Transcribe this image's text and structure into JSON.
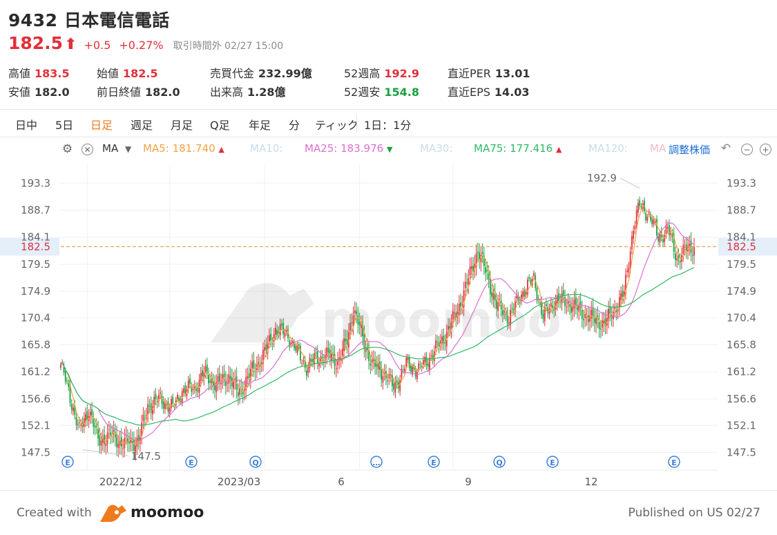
{
  "header": {
    "title": "9432 日本電信電話",
    "price": "182.5",
    "arrow": "⬆",
    "change": "+0.5",
    "change_pct": "+0.27%",
    "session": "取引時間外 02/27 15:00"
  },
  "stats": [
    {
      "label": "高値",
      "value": "183.5",
      "color": "red"
    },
    {
      "label": "安値",
      "value": "182.0",
      "color": "dark"
    },
    {
      "label": "始値",
      "value": "182.5",
      "color": "red"
    },
    {
      "label": "前日終値",
      "value": "182.0",
      "color": "dark"
    },
    {
      "label": "売買代金",
      "value": "232.99億",
      "color": "dark"
    },
    {
      "label": "出来高",
      "value": "1.28億",
      "color": "dark"
    },
    {
      "label": "52週高",
      "value": "192.9",
      "color": "red"
    },
    {
      "label": "52週安",
      "value": "154.8",
      "color": "green"
    },
    {
      "label": "直近PER",
      "value": "13.01",
      "color": "dark"
    },
    {
      "label": "直近EPS",
      "value": "14.03",
      "color": "dark"
    }
  ],
  "period_tabs": [
    "日中",
    "5日",
    "日足",
    "週足",
    "月足",
    "Q足",
    "年足",
    "分",
    "ティック"
  ],
  "active_tab": "日足",
  "interval_label": "1日：1分",
  "indicators": {
    "ma_label": "MA",
    "items": [
      {
        "label": "MA5:",
        "value": "181.740",
        "dir": "▲",
        "color": "#f5a142"
      },
      {
        "label": "MA10:",
        "value": "",
        "dir": "",
        "color": "#c8dcec"
      },
      {
        "label": "MA25:",
        "value": "183.976",
        "dir": "▼",
        "color": "#dd6fd0"
      },
      {
        "label": "MA30:",
        "value": "",
        "dir": "",
        "color": "#c8dcec"
      },
      {
        "label": "MA75:",
        "value": "177.416",
        "dir": "▲",
        "color": "#2db864"
      },
      {
        "label": "MA120:",
        "value": "",
        "dir": "",
        "color": "#c8dcec"
      },
      {
        "label": "MA",
        "value": "",
        "dir": "",
        "color": "#f4b8c8"
      }
    ],
    "adjust_label": "調整株価"
  },
  "colors": {
    "up": "#e0303a",
    "down": "#17a23e",
    "accent": "#f07b1d",
    "ma5": "#f5a142",
    "ma25": "#dd6fd0",
    "ma75": "#2db864",
    "price_line": "#f0a050"
  },
  "chart_data": {
    "type": "candlestick",
    "y_ticks": [
      "193.3",
      "188.7",
      "184.1",
      "179.5",
      "174.9",
      "170.4",
      "165.8",
      "161.2",
      "156.6",
      "152.1",
      "147.5"
    ],
    "ylim": [
      144.5,
      196.5
    ],
    "x_labels": [
      "2022/12",
      "2023/03",
      "6",
      "9",
      "12"
    ],
    "current_price": "182.5",
    "high_annotation": "192.9",
    "low_annotation": "147.5",
    "event_markers": [
      {
        "type": "E",
        "x": "2022/11"
      },
      {
        "type": "E",
        "x": "2023/02"
      },
      {
        "type": "Q",
        "x": "2023/03"
      },
      {
        "type": "…",
        "x": "2023/07"
      },
      {
        "type": "E",
        "x": "2023/08"
      },
      {
        "type": "Q",
        "x": "2023/09"
      },
      {
        "type": "E",
        "x": "2023/11"
      },
      {
        "type": "E",
        "x": "2024/02"
      }
    ],
    "close_anchors": [
      {
        "i": 0,
        "v": 162.5
      },
      {
        "i": 6,
        "v": 157.0
      },
      {
        "i": 12,
        "v": 151.0
      },
      {
        "i": 18,
        "v": 155.0
      },
      {
        "i": 24,
        "v": 149.5
      },
      {
        "i": 32,
        "v": 150.5
      },
      {
        "i": 40,
        "v": 149.0
      },
      {
        "i": 50,
        "v": 149.5
      },
      {
        "i": 56,
        "v": 155.5
      },
      {
        "i": 64,
        "v": 156.5
      },
      {
        "i": 72,
        "v": 155.0
      },
      {
        "i": 78,
        "v": 158.0
      },
      {
        "i": 86,
        "v": 158.5
      },
      {
        "i": 92,
        "v": 161.0
      },
      {
        "i": 100,
        "v": 159.0
      },
      {
        "i": 108,
        "v": 160.5
      },
      {
        "i": 114,
        "v": 157.5
      },
      {
        "i": 122,
        "v": 161.0
      },
      {
        "i": 130,
        "v": 164.0
      },
      {
        "i": 138,
        "v": 168.5
      },
      {
        "i": 146,
        "v": 167.5
      },
      {
        "i": 152,
        "v": 164.5
      },
      {
        "i": 158,
        "v": 162.0
      },
      {
        "i": 164,
        "v": 163.5
      },
      {
        "i": 172,
        "v": 164.0
      },
      {
        "i": 178,
        "v": 163.0
      },
      {
        "i": 184,
        "v": 166.5
      },
      {
        "i": 188,
        "v": 172.0
      },
      {
        "i": 194,
        "v": 167.0
      },
      {
        "i": 200,
        "v": 162.5
      },
      {
        "i": 208,
        "v": 161.0
      },
      {
        "i": 214,
        "v": 158.5
      },
      {
        "i": 222,
        "v": 162.5
      },
      {
        "i": 230,
        "v": 161.5
      },
      {
        "i": 238,
        "v": 164.0
      },
      {
        "i": 246,
        "v": 167.0
      },
      {
        "i": 254,
        "v": 171.0
      },
      {
        "i": 262,
        "v": 177.0
      },
      {
        "i": 268,
        "v": 182.0
      },
      {
        "i": 274,
        "v": 177.5
      },
      {
        "i": 280,
        "v": 172.5
      },
      {
        "i": 288,
        "v": 170.5
      },
      {
        "i": 296,
        "v": 174.5
      },
      {
        "i": 304,
        "v": 177.0
      },
      {
        "i": 310,
        "v": 170.5
      },
      {
        "i": 318,
        "v": 173.5
      },
      {
        "i": 326,
        "v": 173.0
      },
      {
        "i": 334,
        "v": 171.5
      },
      {
        "i": 342,
        "v": 170.0
      },
      {
        "i": 350,
        "v": 169.5
      },
      {
        "i": 356,
        "v": 172.0
      },
      {
        "i": 362,
        "v": 174.5
      },
      {
        "i": 368,
        "v": 186.0
      },
      {
        "i": 372,
        "v": 189.5
      },
      {
        "i": 378,
        "v": 188.0
      },
      {
        "i": 384,
        "v": 184.0
      },
      {
        "i": 390,
        "v": 185.5
      },
      {
        "i": 396,
        "v": 180.5
      },
      {
        "i": 402,
        "v": 182.0
      },
      {
        "i": 407,
        "v": 182.5
      }
    ]
  },
  "footer": {
    "created_with": "Created with",
    "brand": "moomoo",
    "published": "Published on US 02/27"
  }
}
